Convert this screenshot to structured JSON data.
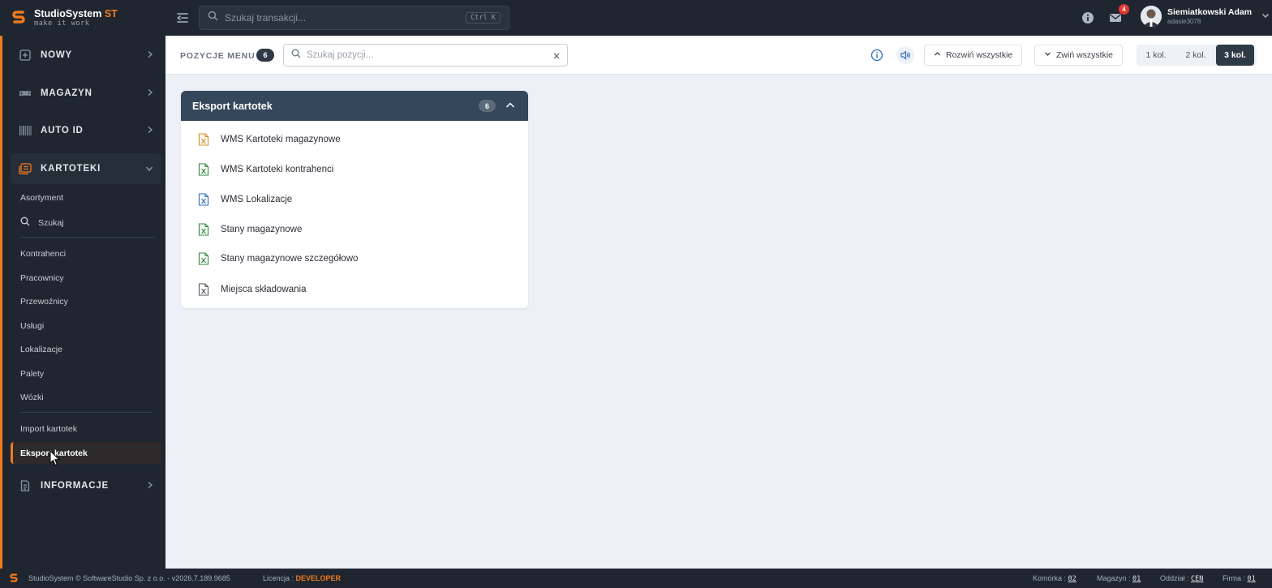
{
  "app": {
    "name": "StudioSystem",
    "name_suffix": "ST",
    "tagline": "make it work"
  },
  "topbar": {
    "search_placeholder": "Szukaj transakcji...",
    "search_shortcut": "Ctrl K",
    "mail_badge": "4",
    "user_name": "Siemiatkowski Adam",
    "user_login": "adasie3078"
  },
  "sidebar": {
    "sections": [
      {
        "label": "NOWY",
        "icon": "plus-square-icon"
      },
      {
        "label": "MAGAZYN",
        "icon": "warehouse-icon"
      },
      {
        "label": "AUTO ID",
        "icon": "barcode-icon"
      },
      {
        "label": "KARTOTEKI",
        "icon": "cards-icon"
      },
      {
        "label": "INFORMACJE",
        "icon": "document-icon"
      }
    ],
    "items": [
      "Asortyment",
      "Szukaj",
      "Kontrahenci",
      "Pracownicy",
      "Przewoźnicy",
      "Usługi",
      "Lokalizacje",
      "Palety",
      "Wózki",
      "Import kartotek",
      "Eksport kartotek"
    ],
    "accent_color": "#f07a1e"
  },
  "toolbar": {
    "title": "POZYCJE MENU",
    "count": "6",
    "search_placeholder": "Szukaj pozycji...",
    "expand_all": "Rozwiń wszystkie",
    "collapse_all": "Zwiń wszystkie",
    "columns": [
      "1 kol.",
      "2 kol.",
      "3 kol."
    ],
    "active_columns": "3 kol."
  },
  "card": {
    "title": "Eksport kartotek",
    "count": "6",
    "items": [
      {
        "label": "WMS Kartoteki magazynowe",
        "icon": "excel-file-icon",
        "color": "#d98b1f"
      },
      {
        "label": "WMS Kartoteki kontrahenci",
        "icon": "excel-file-icon",
        "color": "#2e8b3e"
      },
      {
        "label": "WMS Lokalizacje",
        "icon": "excel-file-icon",
        "color": "#2f6fbf"
      },
      {
        "label": "Stany magazynowe",
        "icon": "excel-file-icon",
        "color": "#2e8b3e"
      },
      {
        "label": "Stany magazynowe szczegółowo",
        "icon": "excel-file-icon",
        "color": "#2e8b3e"
      },
      {
        "label": "Miejsca składowania",
        "icon": "excel-file-icon",
        "color": "#555b63"
      }
    ]
  },
  "footer": {
    "copyright": "StudioSystem © SoftwareStudio Sp. z o.o. - v2026.7.189.9685",
    "license_label": "Licencja :",
    "license_value": "DEVELOPER",
    "cell_label": "Komórka :",
    "cell_value": "02",
    "warehouse_label": "Magazyn :",
    "warehouse_value": "01",
    "branch_label": "Oddział :",
    "branch_value": "CEN",
    "company_label": "Firma :",
    "company_value": "01"
  }
}
